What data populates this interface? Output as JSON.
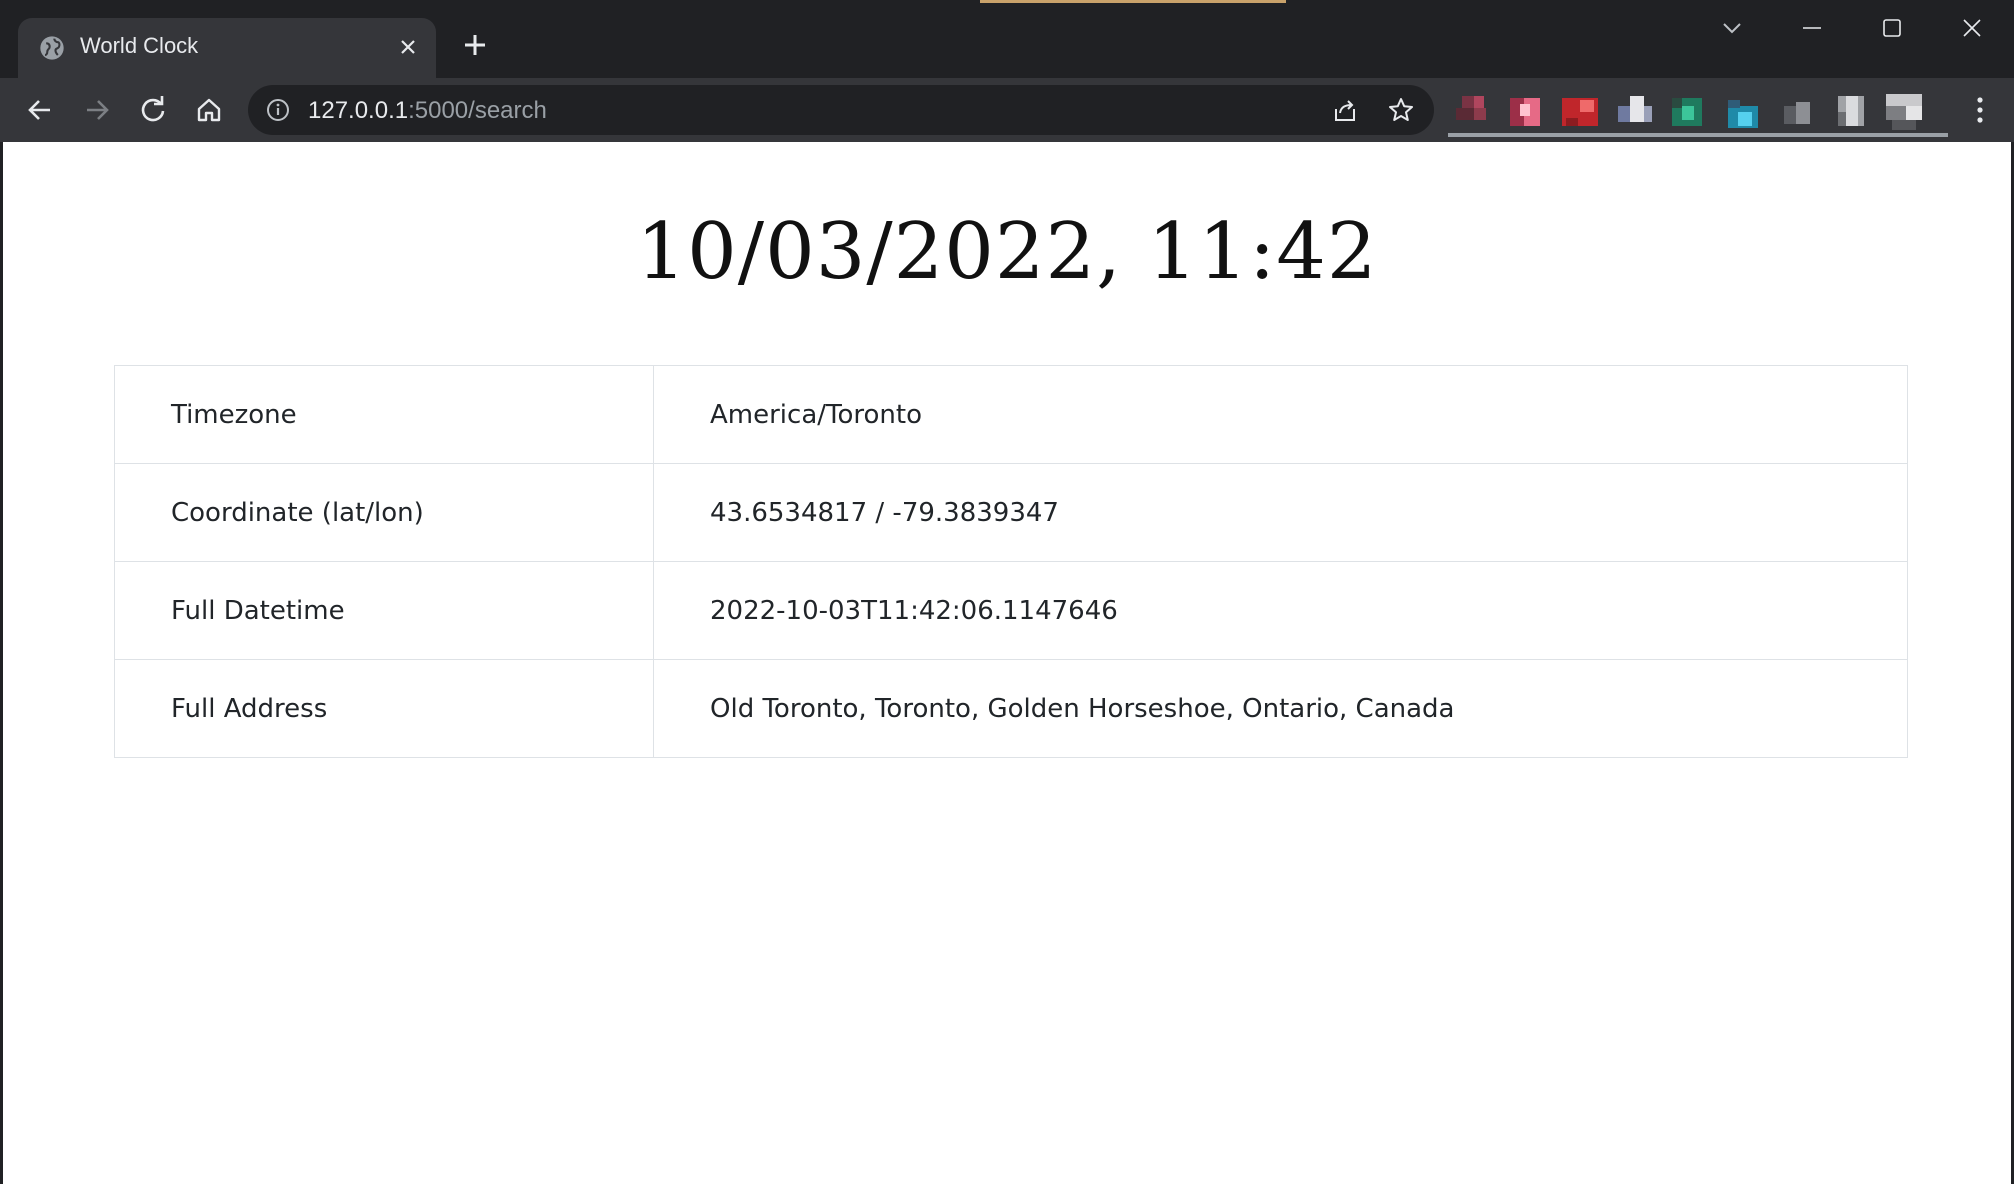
{
  "browser": {
    "tab": {
      "title": "World Clock",
      "favicon": "globe-icon",
      "close_icon": "close-icon"
    },
    "new_tab_icon": "plus-icon",
    "window_controls": [
      "tab-search-icon",
      "minimize-icon",
      "maximize-icon",
      "close-icon"
    ],
    "nav": [
      "back-arrow-icon",
      "forward-arrow-icon",
      "reload-icon",
      "home-icon"
    ],
    "address": {
      "host": "127.0.0.1",
      "path": ":5000/search",
      "security_icon": "info-icon"
    },
    "omnibox_actions": [
      "share-icon",
      "bookmark-star-icon"
    ],
    "extensions_count": 9,
    "menu_icon": "kebab-menu-icon"
  },
  "page": {
    "clock": "10/03/2022, 11:42",
    "rows": [
      {
        "label": "Timezone",
        "value": "America/Toronto"
      },
      {
        "label": "Coordinate (lat/lon)",
        "value": "43.6534817 / -79.3839347"
      },
      {
        "label": "Full Datetime",
        "value": "2022-10-03T11:42:06.1147646"
      },
      {
        "label": "Full Address",
        "value": "Old Toronto, Toronto, Golden Horseshoe, Ontario, Canada"
      }
    ]
  },
  "colors": {
    "titlebar": "#202124",
    "toolbar": "#35363a",
    "page_background": "#ffffff",
    "table_border": "#dee2e6",
    "text": "#212529"
  }
}
